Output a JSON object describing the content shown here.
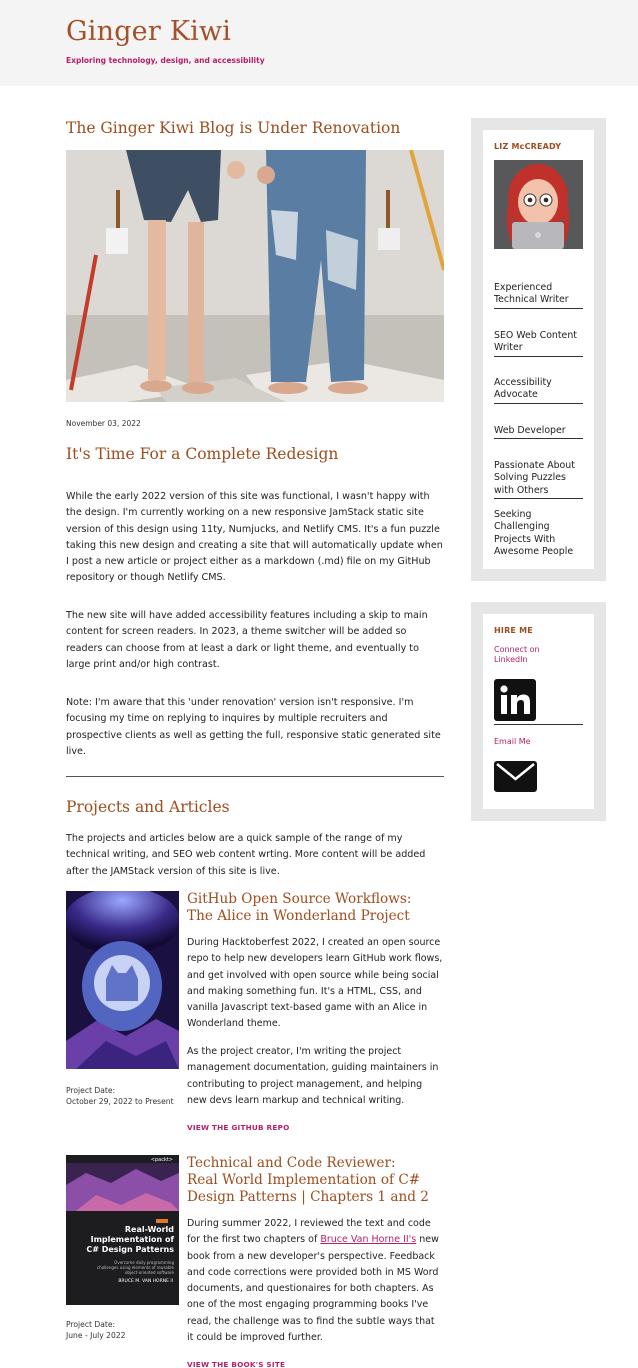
{
  "header": {
    "title": "Ginger Kiwi",
    "tagline": "Exploring technology, design, and accessibility"
  },
  "post": {
    "title": "The Ginger Kiwi Blog is Under Renovation",
    "date": "November 03, 2022",
    "subtitle": "It's Time For a Complete Redesign",
    "paragraphs": [
      "While the early 2022 version of this site was functional, I wasn't happy with the design. I'm currently working on a new responsive JamStack static site version of this design using 11ty, Numjucks, and Netlify CMS. It's a fun puzzle taking this new design and creating a site that will automatically update when I post a new article or project either as a markdown (.md) file on my GitHub repository or though Netlify CMS.",
      "The new site will have added accessibility features including a skip to main content for screen readers. In 2023, a theme switcher will be added so readers can choose from at least a dark or light theme, and eventually to large print and/or high contrast.",
      "Note: I'm aware that this 'under renovation' version isn't responsive. I'm focusing my time on replying to inquires by multiple recruiters and prospective clients as well as getting the full, responsive static generated site live."
    ]
  },
  "projects_section": {
    "title": "Projects and Articles",
    "intro": "The projects and articles below are a quick sample of the range of my technical writing, and SEO web content wrting. More content will be added after the JAMStack version of this site is live.",
    "items": [
      {
        "title_line1": "GitHub Open Source Workflows:",
        "title_line2": "The Alice in Wonderland Project",
        "para1": "During Hacktoberfest 2022, I created an open source repo to help new developers learn GitHub work flows, and get involved with open source while being social and making something fun. It's a HTML, CSS, and vanilla Javascript text-based game with an Alice in Wonderland theme.",
        "para2": "As the project creator, I'm writing the project management documentation, guiding maintainers in contributing to project management, and helping new devs learn markup and technical writing.",
        "date_label": "Project Date:",
        "date_value": "October 29, 2022 to Present",
        "link_label": "VIEW THE GITHUB REPO"
      },
      {
        "title_line1": "Technical and Code Reviewer:",
        "title_line2": "Real World Implementation of C#",
        "title_line3": "Design Patterns | Chapters 1 and 2",
        "para1_before": "During summer 2022, I reviewed the text and code for the first two chapters of ",
        "para1_link": "Bruce Van Horne II's",
        "para1_after": " new book from a new developer's perspective. Feedback and code corrections were provided both in MS Word documents, and questionaires for both chapters. As one of the most engaging programming books I've read, the challenge was to find the subtle ways that it could be improved further.",
        "date_label": "Project Date:",
        "date_value": "June - July 2022",
        "link_label": "VIEW THE BOOK'S SITE",
        "book_cover": {
          "publisher": "<packt>",
          "title_line1": "Real-World",
          "title_line2": "Implementation of",
          "title_line3": "C# Design Patterns",
          "tagline": "Overcome daily programming challenges using elements of reusable object-oriented software",
          "author": "BRUCE M. VAN HORNE II"
        }
      }
    ]
  },
  "sidebar": {
    "profile_heading": "LIZ McCREADY",
    "roles": [
      "Experienced Technical Writer",
      "SEO Web Content Writer",
      "Accessibility Advocate",
      "Web Developer",
      "Passionate About Solving Puzzles with Others",
      "Seeking Challenging Projects With Awesome People"
    ],
    "hire_heading": "HIRE ME",
    "linkedin_label": "Connect on LinkedIn",
    "email_label": "Email Me"
  },
  "colors": {
    "accent_brown": "#9e4d1e",
    "accent_magenta": "#b8206a",
    "header_bg": "#f4f4f4",
    "sidebar_bg": "#e6e6e6"
  }
}
